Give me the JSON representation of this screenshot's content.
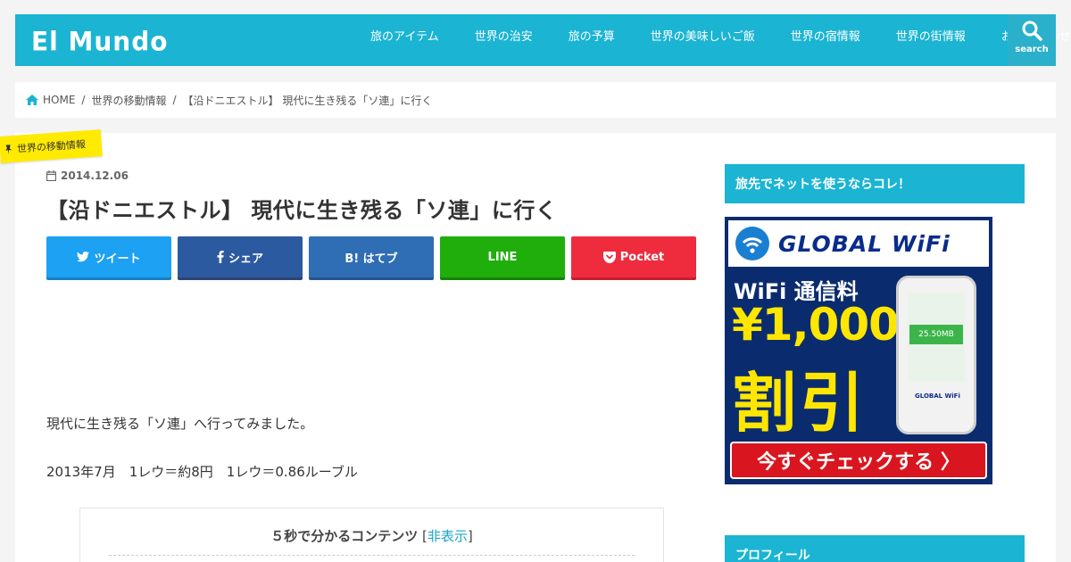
{
  "site": {
    "logo": "El Mundo"
  },
  "nav": {
    "items": [
      {
        "label": "旅のアイテム"
      },
      {
        "label": "世界の治安"
      },
      {
        "label": "旅の予算"
      },
      {
        "label": "世界の美味しいご飯"
      },
      {
        "label": "世界の宿情報"
      },
      {
        "label": "世界の街情報"
      },
      {
        "label": "お問い合わせ"
      }
    ],
    "search_label": "search"
  },
  "breadcrumb": {
    "home": "HOME",
    "category": "世界の移動情報",
    "current": "【沿ドニエストル】 現代に生き残る「ソ連」に行く"
  },
  "article": {
    "category_tag": "世界の移動情報",
    "date": "2014.12.06",
    "title": "【沿ドニエストル】 現代に生き残る「ソ連」に行く",
    "share": {
      "twitter": "ツイート",
      "facebook": "シェア",
      "hatena": "B! はてブ",
      "line": "LINE",
      "pocket": "Pocket"
    },
    "para1": "現代に生き残る「ソ連」へ行ってみました。",
    "para2": "2013年7月　1レウ＝約8円　1レウ＝0.86ルーブル",
    "toc": {
      "title": "５秒で分かるコンテンツ",
      "bracket_open": " [",
      "toggle": "非表示",
      "bracket_close": "]"
    }
  },
  "sidebar": {
    "widget1_title": "旅先でネットを使うならコレ！",
    "widget2_title": "プロフィール",
    "ad": {
      "brand": "GLOBAL WiFi",
      "line1": "WiFi 通信料",
      "price": "¥1,000",
      "discount": "割引",
      "device_screen": "25.50MB",
      "device_logo": "GLOBAL WiFi",
      "cta": "今すぐチェックする 〉"
    }
  },
  "colors": {
    "accent": "#1bb4d3",
    "tag": "#ffea00",
    "twitter": "#1da1f2",
    "facebook": "#2c5aa0",
    "hatena": "#2f6db4",
    "line": "#1fae0b",
    "pocket": "#ee2c3e"
  }
}
